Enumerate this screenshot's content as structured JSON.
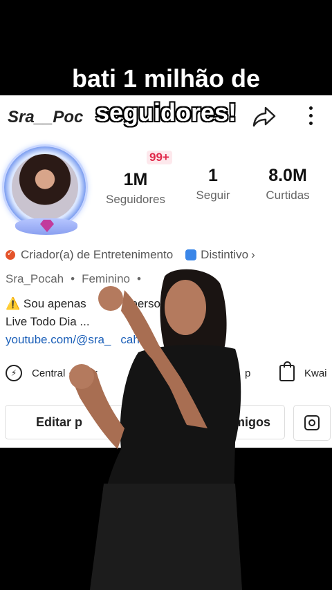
{
  "caption": {
    "line1": "bati 1 milhão de",
    "line2": "seguidores!"
  },
  "profile": {
    "username_visible": "Sra__Poc",
    "notification_badge": "99+",
    "stats": [
      {
        "value": "1M",
        "label": "Seguidores"
      },
      {
        "value": "1",
        "label": "Seguir"
      },
      {
        "value": "8.0M",
        "label": "Curtidas"
      }
    ],
    "creator_label": "Criador(a) de Entretenimento",
    "badge_label": "Distintivo",
    "handle": "Sra_Pocah",
    "gender": "Feminino",
    "bio_line1": "Sou apenas",
    "bio_line1_tail": "perso",
    "bio_line2": "Live Todo Dia ...",
    "bio_link": "youtube.com/@sra_",
    "bio_link_tail": "cah"
  },
  "tools": {
    "creator_center": "Central",
    "creator_center_tail": "riador",
    "shop_tail": "p",
    "kwai": "Kwai"
  },
  "buttons": {
    "edit": "Editar p",
    "friends": "amigos"
  },
  "colors": {
    "accent_red": "#e0294a",
    "link_blue": "#1b5fb8",
    "creator_orange": "#e4532a"
  }
}
